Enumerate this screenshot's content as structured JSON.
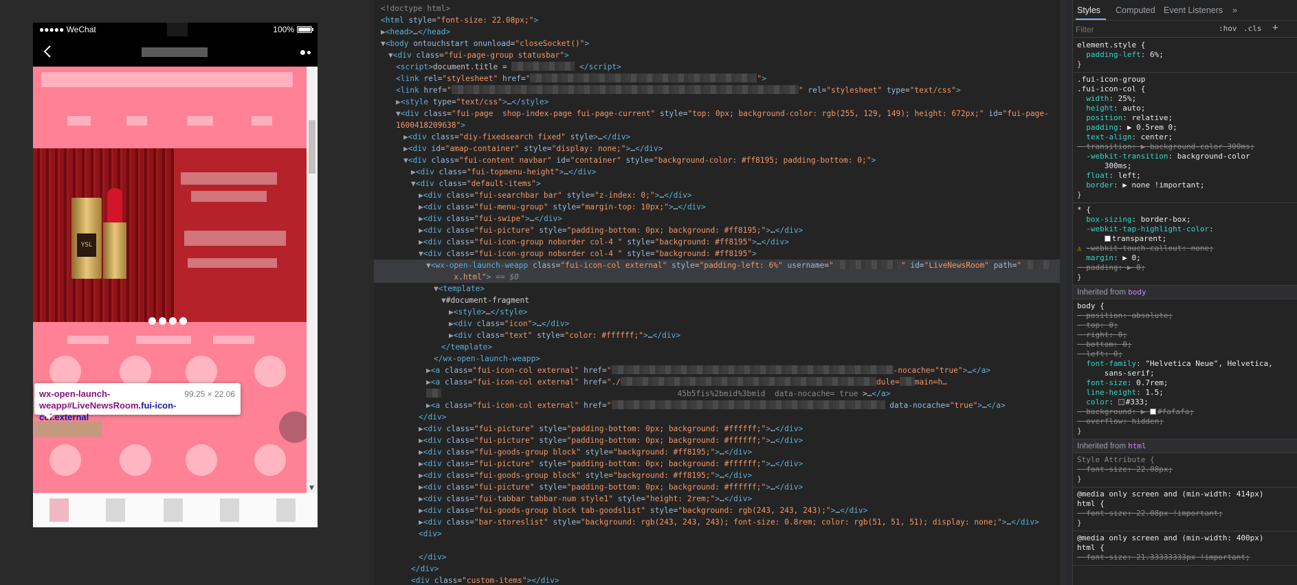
{
  "device": {
    "status_bar": {
      "carrier": "●●●●● WeChat",
      "battery": "100%"
    },
    "tooltip": {
      "element_name": "wx-open-launch-weapp",
      "element_id": "#LiveNewsRoom",
      "element_classes": ".fui-icon-col.external",
      "size": "99.25 × 22.06"
    }
  },
  "elements": {
    "lines": [
      {
        "i": 0,
        "h": "<span class=\"cm\">&lt;!doctype html&gt;</span>"
      },
      {
        "i": 0,
        "h": "<span class=\"tg\">&lt;html</span> <span class=\"an\">style</span>=<span class=\"av\">\"font-size: 22.08px;\"</span><span class=\"tg\">&gt;</span>"
      },
      {
        "i": 0,
        "h": "<span class=\"tri\">▶</span><span class=\"tg\">&lt;head&gt;</span>…<span class=\"tg\">&lt;/head&gt;</span>"
      },
      {
        "i": 0,
        "h": "<span class=\"tri\">▼</span><span class=\"tg\">&lt;body</span> <span class=\"an\">ontouchstart onunload</span>=<span class=\"av\">\"closeSocket()\"</span><span class=\"tg\">&gt;</span>"
      },
      {
        "i": 1,
        "h": "<span class=\"tri\">▼</span><span class=\"tg\">&lt;div</span> <span class=\"an\">class</span>=<span class=\"av\">\"fui-page-group statusbar\"</span><span class=\"tg\">&gt;</span>"
      },
      {
        "i": 2,
        "h": "<span class=\"tg\">&lt;script&gt;</span>document.title = <span class=\"mosaic\" style=\"width:92px\"></span> <span class=\"tg\">&lt;/script&gt;</span>"
      },
      {
        "i": 2,
        "h": "<span class=\"tg\">&lt;link</span> <span class=\"an\">rel</span>=<span class=\"av\">\"stylesheet\"</span> <span class=\"an\">href</span>=<span class=\"av\">\"</span><span class=\"mosaic\" style=\"width:330px\"></span><span class=\"av\">\"</span><span class=\"tg\">&gt;</span>"
      },
      {
        "i": 2,
        "h": "<span class=\"tg\">&lt;link</span> <span class=\"an\">href</span>=<span class=\"av\">\"</span><span class=\"mosaic\" style=\"width:505px\"></span><span class=\"av\">\"</span> <span class=\"an\">rel</span>=<span class=\"av\">\"stylesheet\"</span> <span class=\"an\">type</span>=<span class=\"av\">\"text/css\"</span><span class=\"tg\">&gt;</span>"
      },
      {
        "i": 2,
        "h": "<span class=\"tri\">▶</span><span class=\"tg\">&lt;style</span> <span class=\"an\">type</span>=<span class=\"av\">\"text/css\"</span><span class=\"tg\">&gt;</span>…<span class=\"tg\">&lt;/style&gt;</span>"
      },
      {
        "i": 2,
        "h": "<span class=\"tri\">▼</span><span class=\"tg\">&lt;div</span> <span class=\"an\">class</span>=<span class=\"av\">\"fui-page  shop-index-page fui-page-current\"</span> <span class=\"an\">style</span>=<span class=\"av\">\"top: 0px; background-color: rgb(255, 129, 149); height: 672px;\"</span> <span class=\"an\">id</span>=<span class=\"av\">\"fui-page-</span>"
      },
      {
        "i": 2,
        "h": "<span class=\"av\">1600418209638\"</span><span class=\"tg\">&gt;</span>"
      },
      {
        "i": 3,
        "h": "<span class=\"tri\">▶</span><span class=\"tg\">&lt;div</span> <span class=\"an\">class</span>=<span class=\"av\">\"diy-fixedsearch fixed\"</span> <span class=\"an\">style</span><span class=\"tg\">&gt;</span>…<span class=\"tg\">&lt;/div&gt;</span>"
      },
      {
        "i": 3,
        "h": "<span class=\"tri\">▶</span><span class=\"tg\">&lt;div</span> <span class=\"an\">id</span>=<span class=\"av\">\"amap-container\"</span> <span class=\"an\">style</span>=<span class=\"av\">\"display: none;\"</span><span class=\"tg\">&gt;</span>…<span class=\"tg\">&lt;/div&gt;</span>"
      },
      {
        "i": 3,
        "h": "<span class=\"tri\">▼</span><span class=\"tg\">&lt;div</span> <span class=\"an\">class</span>=<span class=\"av\">\"fui-content navbar\"</span> <span class=\"an\">id</span>=<span class=\"av\">\"container\"</span> <span class=\"an\">style</span>=<span class=\"av\">\"background-color: #ff8195; padding-bottom: 0;\"</span><span class=\"tg\">&gt;</span>"
      },
      {
        "i": 4,
        "h": "<span class=\"tri\">▶</span><span class=\"tg\">&lt;div</span> <span class=\"an\">class</span>=<span class=\"av\">\"fui-topmenu-height\"</span><span class=\"tg\">&gt;</span>…<span class=\"tg\">&lt;/div&gt;</span>"
      },
      {
        "i": 4,
        "h": "<span class=\"tri\">▼</span><span class=\"tg\">&lt;div</span> <span class=\"an\">class</span>=<span class=\"av\">\"default-items\"</span><span class=\"tg\">&gt;</span>"
      },
      {
        "i": 5,
        "h": "<span class=\"tri\">▶</span><span class=\"tg\">&lt;div</span> <span class=\"an\">class</span>=<span class=\"av\">\"fui-searchbar bar\"</span> <span class=\"an\">style</span>=<span class=\"av\">\"z-index: 0;\"</span><span class=\"tg\">&gt;</span>…<span class=\"tg\">&lt;/div&gt;</span>"
      },
      {
        "i": 5,
        "h": "<span class=\"tri\">▶</span><span class=\"tg\">&lt;div</span> <span class=\"an\">class</span>=<span class=\"av\">\"fui-menu-group\"</span> <span class=\"an\">style</span>=<span class=\"av\">\"margin-top: 10px;\"</span><span class=\"tg\">&gt;</span>…<span class=\"tg\">&lt;/div&gt;</span>"
      },
      {
        "i": 5,
        "h": "<span class=\"tri\">▶</span><span class=\"tg\">&lt;div</span> <span class=\"an\">class</span>=<span class=\"av\">\"fui-swipe\"</span><span class=\"tg\">&gt;</span>…<span class=\"tg\">&lt;/div&gt;</span>"
      },
      {
        "i": 5,
        "h": "<span class=\"tri\">▶</span><span class=\"tg\">&lt;div</span> <span class=\"an\">class</span>=<span class=\"av\">\"fui-picture\"</span> <span class=\"an\">style</span>=<span class=\"av\">\"padding-bottom: 0px; background: #ff8195;\"</span><span class=\"tg\">&gt;</span>…<span class=\"tg\">&lt;/div&gt;</span>"
      },
      {
        "i": 5,
        "h": "<span class=\"tri\">▶</span><span class=\"tg\">&lt;div</span> <span class=\"an\">class</span>=<span class=\"av\">\"fui-icon-group noborder col-4 \"</span> <span class=\"an\">style</span>=<span class=\"av\">\"background: #ff8195\"</span><span class=\"tg\">&gt;</span>…<span class=\"tg\">&lt;/div&gt;</span>"
      },
      {
        "i": 5,
        "h": "<span class=\"tri\">▼</span><span class=\"tg\">&lt;div</span> <span class=\"an\">class</span>=<span class=\"av\">\"fui-icon-group noborder col-4 \"</span> <span class=\"an\">style</span>=<span class=\"av\">\"background: #ff8195\"</span><span class=\"tg\">&gt;</span>"
      },
      {
        "i": 6,
        "sel": true,
        "h": "<span class=\"tri\">▼</span><span class=\"tg\">&lt;wx-open-launch-weapp</span> <span class=\"an\">class</span>=<span class=\"av\">\"fui-icon-col external\"</span> <span class=\"an\">style</span>=<span class=\"av\">\"padding-left: 6%\"</span> <span class=\"an\">username</span>=<span class=\"av\">\"</span><span class=\"mosaic\" style=\"width:98px\"></span><span class=\"av\">\"</span> <span class=\"an\">id</span>=<span class=\"av\">\"LiveNewsRoom\"</span> <span class=\"an\">path</span>=<span class=\"av\">\"</span><span class=\"mosaic\" style=\"width:40px\"></span>"
      },
      {
        "i": 6,
        "sel": true,
        "h": "      <span class=\"av\">x.html\"</span><span class=\"tg\">&gt;</span> <span class=\"eq\">== $0</span>"
      },
      {
        "i": 7,
        "h": "<span class=\"tri\">▼</span><span class=\"tg\">&lt;template&gt;</span>"
      },
      {
        "i": 8,
        "h": "<span class=\"tri\">▼</span><span class=\"tx\">#document-fragment</span>"
      },
      {
        "i": 9,
        "h": "<span class=\"tri\">▶</span><span class=\"tg\">&lt;style&gt;</span>…<span class=\"tg\">&lt;/style&gt;</span>"
      },
      {
        "i": 9,
        "h": "<span class=\"tri\">▶</span><span class=\"tg\">&lt;div</span> <span class=\"an\">class</span>=<span class=\"av\">\"icon\"</span><span class=\"tg\">&gt;</span>…<span class=\"tg\">&lt;/div&gt;</span>"
      },
      {
        "i": 9,
        "h": "<span class=\"tri\">▶</span><span class=\"tg\">&lt;div</span> <span class=\"an\">class</span>=<span class=\"av\">\"text\"</span> <span class=\"an\">style</span>=<span class=\"av\">\"color: #ffffff;\"</span><span class=\"tg\">&gt;</span>…<span class=\"tg\">&lt;/div&gt;</span>"
      },
      {
        "i": 8,
        "h": "<span class=\"tg\">&lt;/template&gt;</span>"
      },
      {
        "i": 7,
        "h": "<span class=\"tg\">&lt;/wx-open-launch-weapp&gt;</span>"
      },
      {
        "i": 6,
        "h": "<span class=\"tri\">▶</span><span class=\"tg\">&lt;a</span> <span class=\"an\">class</span>=<span class=\"av\">\"fui-icon-col external\"</span> <span class=\"an\">href</span>=<span class=\"av\">\"</span><span class=\"mosaic\" style=\"width:410px\"></span><span class=\"av\">-nocache=\"true\"</span><span class=\"tg\">&gt;</span>…<span class=\"tg\">&lt;/a&gt;</span>"
      },
      {
        "i": 6,
        "h": "<span class=\"tri\">▶</span><span class=\"tg\">&lt;a</span> <span class=\"an\">class</span>=<span class=\"av\">\"fui-icon-col external\"</span> <span class=\"an\">href</span>=<span class=\"av\">\"./</span><span class=\"mosaic\" style=\"width:372px\"></span><span class=\"av\">dule=</span><span class=\"mosaic\" style=\"width:22px\"></span><span class=\"av\">main=h…</span>"
      },
      {
        "i": 6,
        "h": "<span class=\"mosaic\" style=\"width:22px\"></span>                                                   <span class=\"cm\">45b5fis%2bmid%3bmid  data-nocache= true </span>&gt;…<span class=\"tg\">&lt;/a&gt;</span>"
      },
      {
        "i": 6,
        "h": "<span class=\"tri\">▶</span><span class=\"tg\">&lt;a</span> <span class=\"an\">class</span>=<span class=\"av\">\"fui-icon-col external\"</span> <span class=\"an\">href</span>=<span class=\"av\">\"</span><span class=\"mosaic\" style=\"width:398px\"></span> <span class=\"an\">data-nocache</span>=<span class=\"av\">\"true\"</span><span class=\"tg\">&gt;</span>…<span class=\"tg\">&lt;/a&gt;</span>"
      },
      {
        "i": 5,
        "h": "<span class=\"tg\">&lt;/div&gt;</span>"
      },
      {
        "i": 5,
        "h": "<span class=\"tri\">▶</span><span class=\"tg\">&lt;div</span> <span class=\"an\">class</span>=<span class=\"av\">\"fui-picture\"</span> <span class=\"an\">style</span>=<span class=\"av\">\"padding-bottom: 0px; background: #ffffff;\"</span><span class=\"tg\">&gt;</span>…<span class=\"tg\">&lt;/div&gt;</span>"
      },
      {
        "i": 5,
        "h": "<span class=\"tri\">▶</span><span class=\"tg\">&lt;div</span> <span class=\"an\">class</span>=<span class=\"av\">\"fui-picture\"</span> <span class=\"an\">style</span>=<span class=\"av\">\"padding-bottom: 0px; background: #ffffff;\"</span><span class=\"tg\">&gt;</span>…<span class=\"tg\">&lt;/div&gt;</span>"
      },
      {
        "i": 5,
        "h": "<span class=\"tri\">▶</span><span class=\"tg\">&lt;div</span> <span class=\"an\">class</span>=<span class=\"av\">\"fui-goods-group block\"</span> <span class=\"an\">style</span>=<span class=\"av\">\"background: #ff8195;\"</span><span class=\"tg\">&gt;</span>…<span class=\"tg\">&lt;/div&gt;</span>"
      },
      {
        "i": 5,
        "h": "<span class=\"tri\">▶</span><span class=\"tg\">&lt;div</span> <span class=\"an\">class</span>=<span class=\"av\">\"fui-picture\"</span> <span class=\"an\">style</span>=<span class=\"av\">\"padding-bottom: 0px; background: #ffffff;\"</span><span class=\"tg\">&gt;</span>…<span class=\"tg\">&lt;/div&gt;</span>"
      },
      {
        "i": 5,
        "h": "<span class=\"tri\">▶</span><span class=\"tg\">&lt;div</span> <span class=\"an\">class</span>=<span class=\"av\">\"fui-goods-group block\"</span> <span class=\"an\">style</span>=<span class=\"av\">\"background: #ff8195;\"</span><span class=\"tg\">&gt;</span>…<span class=\"tg\">&lt;/div&gt;</span>"
      },
      {
        "i": 5,
        "h": "<span class=\"tri\">▶</span><span class=\"tg\">&lt;div</span> <span class=\"an\">class</span>=<span class=\"av\">\"fui-picture\"</span> <span class=\"an\">style</span>=<span class=\"av\">\"padding-bottom: 0px; background: #ffffff;\"</span><span class=\"tg\">&gt;</span>…<span class=\"tg\">&lt;/div&gt;</span>"
      },
      {
        "i": 5,
        "h": "<span class=\"tri\">▶</span><span class=\"tg\">&lt;div</span> <span class=\"an\">class</span>=<span class=\"av\">\"fui-tabbar tabbar-num style1\"</span> <span class=\"an\">style</span>=<span class=\"av\">\"height: 2rem;\"</span><span class=\"tg\">&gt;</span>…<span class=\"tg\">&lt;/div&gt;</span>"
      },
      {
        "i": 5,
        "h": "<span class=\"tri\">▶</span><span class=\"tg\">&lt;div</span> <span class=\"an\">class</span>=<span class=\"av\">\"fui-goods-group block tab-goodslist\"</span> <span class=\"an\">style</span>=<span class=\"av\">\"background: rgb(243, 243, 243);\"</span><span class=\"tg\">&gt;</span>…<span class=\"tg\">&lt;/div&gt;</span>"
      },
      {
        "i": 5,
        "h": "<span class=\"tri\">▶</span><span class=\"tg\">&lt;div</span> <span class=\"an\">class</span>=<span class=\"av\">\"bar-storeslist\"</span> <span class=\"an\">style</span>=<span class=\"av\">\"background: rgb(243, 243, 243); font-size: 0.8rem; color: rgb(51, 51, 51); display: none;\"</span><span class=\"tg\">&gt;</span>…<span class=\"tg\">&lt;/div&gt;</span>"
      },
      {
        "i": 5,
        "h": "<span class=\"tg\">&lt;div&gt;</span>"
      },
      {
        "i": 5,
        "h": ""
      },
      {
        "i": 5,
        "h": "<span class=\"tg\">&lt;/div&gt;</span>"
      },
      {
        "i": 4,
        "h": "<span class=\"tg\">&lt;/div&gt;</span>"
      },
      {
        "i": 4,
        "h": "<span class=\"tg\">&lt;div</span> <span class=\"an\">class</span>=<span class=\"av\">\"custom-items\"</span><span class=\"tg\">&gt;</span><span class=\"tg\">&lt;/div&gt;</span>"
      }
    ]
  },
  "styles": {
    "tabs": {
      "styles": "Styles",
      "computed": "Computed",
      "event_listeners": "Event Listeners",
      "more": "»"
    },
    "filter_placeholder": "Filter",
    "hov": ":hov",
    "cls": ".cls",
    "plus": "+",
    "inherited_body_label": "Inherited from",
    "inherited_body_tag": "body",
    "inherited_html_label": "Inherited from",
    "inherited_html_tag": "html"
  }
}
